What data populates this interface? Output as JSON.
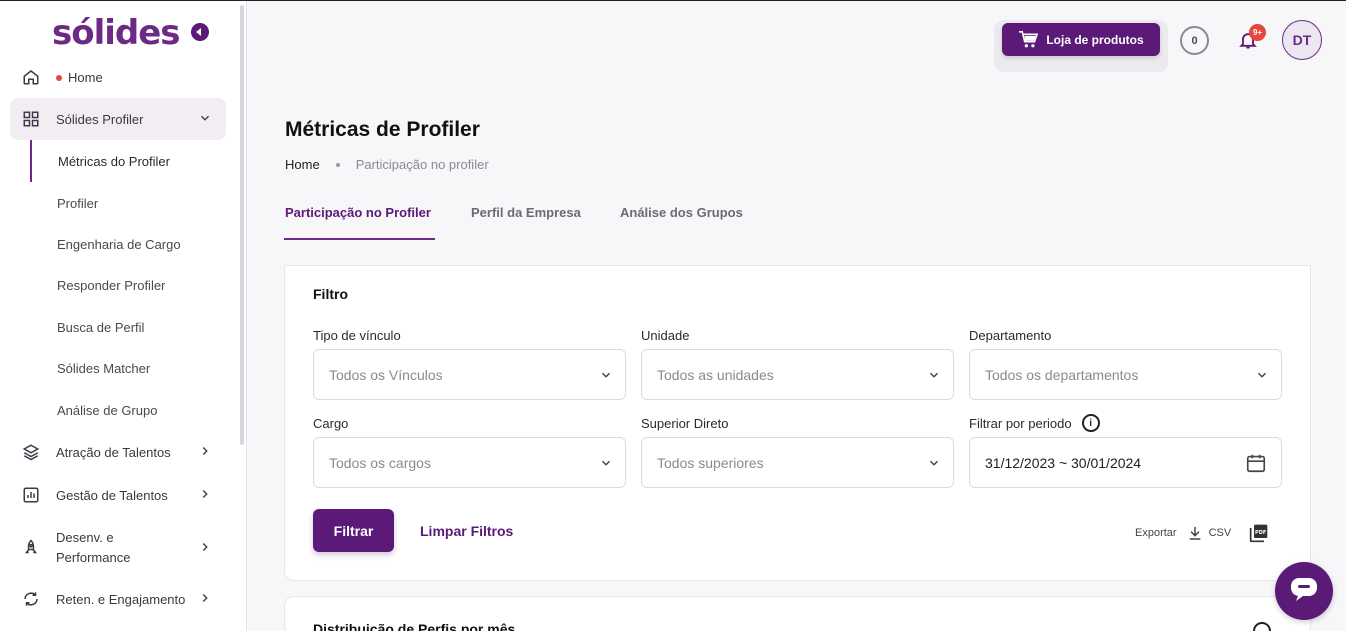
{
  "brand": {
    "logo_text": "sólides"
  },
  "sidebar": {
    "home": {
      "label": "Home"
    },
    "profiler": {
      "label": "Sólides Profiler"
    },
    "subitems": [
      {
        "label": "Métricas do Profiler"
      },
      {
        "label": "Profiler"
      },
      {
        "label": "Engenharia de Cargo"
      },
      {
        "label": "Responder Profiler"
      },
      {
        "label": "Busca de Perfil"
      },
      {
        "label": "Sólides Matcher"
      },
      {
        "label": "Análise de Grupo"
      }
    ],
    "sections": [
      {
        "label": "Atração de Talentos"
      },
      {
        "label": "Gestão de Talentos"
      },
      {
        "label": "Desenv. e",
        "label2": "Performance"
      },
      {
        "label": "Reten. e Engajamento"
      }
    ]
  },
  "header": {
    "shop_label": "Loja de produtos",
    "counter": "0",
    "notifications_badge": "9+",
    "avatar_initials": "DT"
  },
  "page": {
    "title": "Métricas de Profiler",
    "breadcrumb": {
      "home": "Home",
      "current": "Participação no profiler"
    },
    "tabs": [
      {
        "label": "Participação no Profiler"
      },
      {
        "label": "Perfil da Empresa"
      },
      {
        "label": "Análise dos Grupos"
      }
    ]
  },
  "filter": {
    "title": "Filtro",
    "fields": [
      {
        "label": "Tipo de vínculo",
        "placeholder": "Todos os Vínculos"
      },
      {
        "label": "Unidade",
        "placeholder": "Todos as unidades"
      },
      {
        "label": "Departamento",
        "placeholder": "Todos os departamentos"
      },
      {
        "label": "Cargo",
        "placeholder": "Todos os cargos"
      },
      {
        "label": "Superior Direto",
        "placeholder": "Todos superiores"
      },
      {
        "label": "Filtrar por periodo",
        "value": "31/12/2023 ~ 30/01/2024"
      }
    ],
    "filter_button": "Filtrar",
    "clear_button": "Limpar Filtros",
    "export_label": "Exportar",
    "csv_label": "CSV"
  },
  "distribution": {
    "title": "Distribuição de Perfis por mês"
  },
  "colors": {
    "primary": "#5b1a78",
    "accent": "#6c2a86",
    "alert": "#e8453c"
  }
}
